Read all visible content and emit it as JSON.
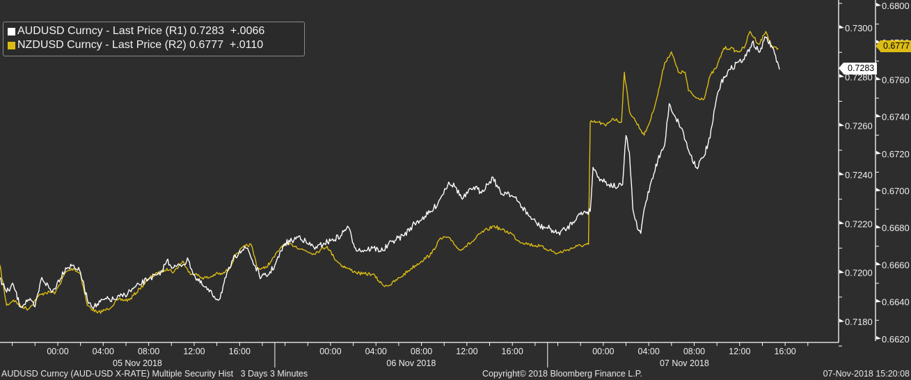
{
  "legend": {
    "items": [
      {
        "label": "AUDUSD Curncy - Last Price (R1) 0.7283  +.0066",
        "color": "#ffffff"
      },
      {
        "label": "NZDUSD Curncy - Last Price (R2) 0.6777  +.0110",
        "color": "#dcbc14"
      }
    ]
  },
  "current_labels": {
    "aud": "0.7283",
    "nzd": "0.6777"
  },
  "footer": {
    "left": "AUDUSD Curncy (AUD-USD X-RATE) Multiple Security Hist   3 Days 3 Minutes",
    "center": "Copyright© 2018 Bloomberg Finance L.P.",
    "right": "07-Nov-2018 15:20:08"
  },
  "colors": {
    "background": "#2d2d2d",
    "aud": "#ffffff",
    "nzd": "#dcbc14",
    "axis": "#ffffff"
  },
  "chart_data": {
    "type": "line",
    "title": "",
    "x_unit": "hours from 05 Nov 2018 00:00",
    "x_tick_labels": [
      "00:00",
      "04:00",
      "08:00",
      "12:00",
      "16:00"
    ],
    "x_tick_hours": [
      0,
      4,
      8,
      12,
      16,
      24,
      28,
      32,
      36,
      40,
      48,
      52,
      56,
      60,
      64
    ],
    "day_labels": [
      "05 Nov 2018",
      "06 Nov 2018",
      "07 Nov 2018"
    ],
    "xlim": [
      -5.1,
      67.2
    ],
    "axes": {
      "R1": {
        "ylim": [
          0.7172,
          0.7312
        ],
        "ticks": [
          "0.7180",
          "0.7200",
          "0.7220",
          "0.7240",
          "0.7260",
          "0.7280",
          "0.7300"
        ]
      },
      "R2": {
        "ylim": [
          0.6618,
          0.6803
        ],
        "ticks": [
          "0.6620",
          "0.6640",
          "0.6660",
          "0.6680",
          "0.6700",
          "0.6720",
          "0.6740",
          "0.6760",
          "0.6780",
          "0.6800"
        ]
      }
    },
    "grid": false,
    "legend_position": "top-left",
    "series": [
      {
        "name": "AUDUSD Curncy - Last Price",
        "axis": "R1",
        "last": 0.7283,
        "change": 0.0066,
        "points": [
          [
            -5.1,
            0.7198
          ],
          [
            -4.5,
            0.7192
          ],
          [
            -3.9,
            0.7195
          ],
          [
            -3.3,
            0.7186
          ],
          [
            -2.6,
            0.7189
          ],
          [
            -2.0,
            0.7186
          ],
          [
            -1.4,
            0.7198
          ],
          [
            -0.5,
            0.7192
          ],
          [
            0.7,
            0.7202
          ],
          [
            1.4,
            0.7203
          ],
          [
            2.0,
            0.72
          ],
          [
            2.6,
            0.7189
          ],
          [
            3.2,
            0.7186
          ],
          [
            4.1,
            0.7189
          ],
          [
            5.0,
            0.7189
          ],
          [
            5.9,
            0.7191
          ],
          [
            7.2,
            0.7195
          ],
          [
            8.1,
            0.7198
          ],
          [
            9.0,
            0.7199
          ],
          [
            9.6,
            0.7205
          ],
          [
            10.2,
            0.7202
          ],
          [
            10.8,
            0.7203
          ],
          [
            11.5,
            0.7205
          ],
          [
            12.1,
            0.7198
          ],
          [
            12.7,
            0.7195
          ],
          [
            13.6,
            0.7191
          ],
          [
            14.2,
            0.7189
          ],
          [
            14.8,
            0.7198
          ],
          [
            15.4,
            0.7205
          ],
          [
            16.0,
            0.7209
          ],
          [
            16.7,
            0.721
          ],
          [
            17.3,
            0.7203
          ],
          [
            17.9,
            0.7198
          ],
          [
            18.5,
            0.7199
          ],
          [
            19.1,
            0.7203
          ],
          [
            20.0,
            0.7212
          ],
          [
            20.6,
            0.7213
          ],
          [
            21.3,
            0.7215
          ],
          [
            21.9,
            0.7212
          ],
          [
            22.8,
            0.721
          ],
          [
            23.4,
            0.7212
          ],
          [
            24.0,
            0.7213
          ],
          [
            24.9,
            0.7215
          ],
          [
            25.5,
            0.7219
          ],
          [
            26.2,
            0.721
          ],
          [
            26.8,
            0.7209
          ],
          [
            27.7,
            0.721
          ],
          [
            28.6,
            0.7209
          ],
          [
            29.5,
            0.7213
          ],
          [
            30.4,
            0.7215
          ],
          [
            31.4,
            0.722
          ],
          [
            32.3,
            0.7223
          ],
          [
            32.9,
            0.7225
          ],
          [
            33.5,
            0.7229
          ],
          [
            34.4,
            0.7237
          ],
          [
            35.0,
            0.7235
          ],
          [
            35.6,
            0.723
          ],
          [
            36.6,
            0.7235
          ],
          [
            37.2,
            0.7233
          ],
          [
            37.8,
            0.7236
          ],
          [
            38.3,
            0.7239
          ],
          [
            39.0,
            0.7232
          ],
          [
            39.6,
            0.7233
          ],
          [
            40.5,
            0.7229
          ],
          [
            41.5,
            0.7223
          ],
          [
            42.4,
            0.7219
          ],
          [
            43.3,
            0.7218
          ],
          [
            43.9,
            0.7216
          ],
          [
            44.8,
            0.7218
          ],
          [
            45.7,
            0.7223
          ],
          [
            46.4,
            0.7225
          ],
          [
            46.85,
            0.7225
          ],
          [
            47.1,
            0.7243
          ],
          [
            47.6,
            0.7239
          ],
          [
            48.5,
            0.7236
          ],
          [
            49.3,
            0.7235
          ],
          [
            49.7,
            0.7236
          ],
          [
            50.0,
            0.7256
          ],
          [
            50.3,
            0.7249
          ],
          [
            50.6,
            0.7226
          ],
          [
            51.0,
            0.7218
          ],
          [
            51.3,
            0.7216
          ],
          [
            51.6,
            0.7226
          ],
          [
            52.2,
            0.7237
          ],
          [
            52.8,
            0.7246
          ],
          [
            53.4,
            0.7252
          ],
          [
            53.8,
            0.7269
          ],
          [
            54.3,
            0.7264
          ],
          [
            54.9,
            0.7259
          ],
          [
            55.5,
            0.725
          ],
          [
            56.2,
            0.7243
          ],
          [
            56.8,
            0.7247
          ],
          [
            57.4,
            0.7255
          ],
          [
            58.0,
            0.7272
          ],
          [
            58.6,
            0.728
          ],
          [
            59.2,
            0.7283
          ],
          [
            59.8,
            0.7286
          ],
          [
            60.4,
            0.7287
          ],
          [
            61.1,
            0.7294
          ],
          [
            61.7,
            0.729
          ],
          [
            62.3,
            0.7296
          ],
          [
            62.9,
            0.7292
          ],
          [
            63.5,
            0.7283
          ]
        ]
      },
      {
        "name": "NZDUSD Curncy - Last Price",
        "axis": "R2",
        "last": 0.6777,
        "change": 0.011,
        "points": [
          [
            -5.1,
            0.666
          ],
          [
            -4.5,
            0.6638
          ],
          [
            -3.9,
            0.6641
          ],
          [
            -3.3,
            0.6638
          ],
          [
            -2.6,
            0.6636
          ],
          [
            -1.7,
            0.6643
          ],
          [
            -1.1,
            0.6645
          ],
          [
            -0.2,
            0.6645
          ],
          [
            0.7,
            0.6656
          ],
          [
            1.4,
            0.6658
          ],
          [
            2.0,
            0.6655
          ],
          [
            2.6,
            0.6638
          ],
          [
            3.5,
            0.6634
          ],
          [
            4.4,
            0.6636
          ],
          [
            5.3,
            0.6641
          ],
          [
            6.3,
            0.6641
          ],
          [
            7.2,
            0.6647
          ],
          [
            8.1,
            0.6653
          ],
          [
            9.0,
            0.6656
          ],
          [
            9.6,
            0.6658
          ],
          [
            10.2,
            0.6656
          ],
          [
            11.0,
            0.6662
          ],
          [
            11.5,
            0.6656
          ],
          [
            12.1,
            0.6655
          ],
          [
            12.7,
            0.6653
          ],
          [
            13.3,
            0.6653
          ],
          [
            13.9,
            0.6655
          ],
          [
            14.5,
            0.6655
          ],
          [
            15.1,
            0.6658
          ],
          [
            15.7,
            0.6666
          ],
          [
            16.5,
            0.667
          ],
          [
            17.0,
            0.6671
          ],
          [
            17.6,
            0.6658
          ],
          [
            18.2,
            0.6658
          ],
          [
            18.8,
            0.6662
          ],
          [
            19.7,
            0.667
          ],
          [
            20.6,
            0.6671
          ],
          [
            21.6,
            0.6668
          ],
          [
            22.5,
            0.6666
          ],
          [
            23.1,
            0.6668
          ],
          [
            23.7,
            0.667
          ],
          [
            24.3,
            0.6664
          ],
          [
            24.9,
            0.666
          ],
          [
            25.5,
            0.6658
          ],
          [
            26.2,
            0.6656
          ],
          [
            26.8,
            0.6655
          ],
          [
            27.7,
            0.6655
          ],
          [
            28.6,
            0.6649
          ],
          [
            29.2,
            0.6649
          ],
          [
            30.1,
            0.6653
          ],
          [
            31.1,
            0.6658
          ],
          [
            32.0,
            0.6662
          ],
          [
            32.9,
            0.6666
          ],
          [
            33.5,
            0.6673
          ],
          [
            34.1,
            0.6675
          ],
          [
            34.7,
            0.6673
          ],
          [
            35.3,
            0.6668
          ],
          [
            35.9,
            0.667
          ],
          [
            36.6,
            0.6673
          ],
          [
            37.2,
            0.6677
          ],
          [
            37.8,
            0.6679
          ],
          [
            38.4,
            0.6681
          ],
          [
            39.0,
            0.6679
          ],
          [
            39.9,
            0.6677
          ],
          [
            40.5,
            0.6673
          ],
          [
            41.5,
            0.6671
          ],
          [
            42.4,
            0.667
          ],
          [
            43.3,
            0.6668
          ],
          [
            43.9,
            0.6666
          ],
          [
            44.8,
            0.6668
          ],
          [
            45.7,
            0.667
          ],
          [
            46.7,
            0.6671
          ],
          [
            46.85,
            0.6737
          ],
          [
            47.6,
            0.6737
          ],
          [
            48.2,
            0.6735
          ],
          [
            48.8,
            0.6739
          ],
          [
            49.6,
            0.6737
          ],
          [
            49.85,
            0.6764
          ],
          [
            50.3,
            0.6743
          ],
          [
            50.9,
            0.6737
          ],
          [
            51.6,
            0.673
          ],
          [
            52.2,
            0.6739
          ],
          [
            52.8,
            0.6752
          ],
          [
            53.4,
            0.6769
          ],
          [
            54.0,
            0.6775
          ],
          [
            54.6,
            0.6764
          ],
          [
            55.2,
            0.6764
          ],
          [
            55.5,
            0.6754
          ],
          [
            56.2,
            0.675
          ],
          [
            56.9,
            0.675
          ],
          [
            57.4,
            0.6762
          ],
          [
            58.0,
            0.6767
          ],
          [
            58.6,
            0.6777
          ],
          [
            59.2,
            0.6777
          ],
          [
            59.8,
            0.6775
          ],
          [
            60.4,
            0.6777
          ],
          [
            60.9,
            0.6786
          ],
          [
            61.7,
            0.6779
          ],
          [
            62.3,
            0.6786
          ],
          [
            62.9,
            0.6777
          ],
          [
            63.4,
            0.6777
          ]
        ]
      }
    ]
  }
}
